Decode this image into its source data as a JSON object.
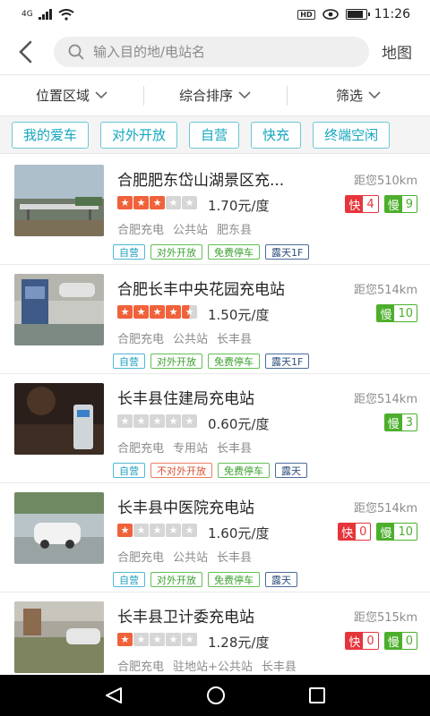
{
  "status_bar": {
    "network": "4G",
    "time": "11:26"
  },
  "header": {
    "back_icon": "back-chevron-icon",
    "search_placeholder": "输入目的地/电站名",
    "map_label": "地图"
  },
  "filters": [
    {
      "label": "位置区域"
    },
    {
      "label": "综合排序"
    },
    {
      "label": "筛选"
    }
  ],
  "quick_tags": [
    "我的爱车",
    "对外开放",
    "自营",
    "快充",
    "终端空闲"
  ],
  "colors": {
    "accent": "#13a7bf",
    "fast": "#e5353b",
    "slow": "#4cae2b",
    "star": "#f0623a",
    "star_empty": "#d6d6d6"
  },
  "stations": [
    {
      "name": "合肥肥东岱山湖景区充...",
      "distance": "距您510km",
      "rating": 3,
      "price": "1.70元/度",
      "operator": "合肥充电",
      "type": "公共站",
      "county": "肥东县",
      "fast": {
        "label": "快",
        "count": "4"
      },
      "slow": {
        "label": "慢",
        "count": "9"
      },
      "tags": [
        {
          "text": "自营",
          "style": "blue"
        },
        {
          "text": "对外开放",
          "style": "green"
        },
        {
          "text": "免费停车",
          "style": "green"
        },
        {
          "text": "露天1F",
          "style": "navy"
        }
      ]
    },
    {
      "name": "合肥长丰中央花园充电站",
      "distance": "距您514km",
      "rating": 4.5,
      "price": "1.50元/度",
      "operator": "合肥充电",
      "type": "公共站",
      "county": "长丰县",
      "fast": null,
      "slow": {
        "label": "慢",
        "count": "10"
      },
      "tags": [
        {
          "text": "自营",
          "style": "blue"
        },
        {
          "text": "对外开放",
          "style": "green"
        },
        {
          "text": "免费停车",
          "style": "green"
        },
        {
          "text": "露天1F",
          "style": "navy"
        }
      ]
    },
    {
      "name": "长丰县住建局充电站",
      "distance": "距您514km",
      "rating": 0,
      "price": "0.60元/度",
      "operator": "合肥充电",
      "type": "专用站",
      "county": "长丰县",
      "fast": null,
      "slow": {
        "label": "慢",
        "count": "3"
      },
      "tags": [
        {
          "text": "自营",
          "style": "blue"
        },
        {
          "text": "不对外开放",
          "style": "red"
        },
        {
          "text": "免费停车",
          "style": "green"
        },
        {
          "text": "露天",
          "style": "navy"
        }
      ]
    },
    {
      "name": "长丰县中医院充电站",
      "distance": "距您514km",
      "rating": 1,
      "price": "1.60元/度",
      "operator": "合肥充电",
      "type": "公共站",
      "county": "长丰县",
      "fast": {
        "label": "快",
        "count": "0"
      },
      "slow": {
        "label": "慢",
        "count": "10"
      },
      "tags": [
        {
          "text": "自营",
          "style": "blue"
        },
        {
          "text": "对外开放",
          "style": "green"
        },
        {
          "text": "免费停车",
          "style": "green"
        },
        {
          "text": "露天",
          "style": "navy"
        }
      ]
    },
    {
      "name": "长丰县卫计委充电站",
      "distance": "距您515km",
      "rating": 1,
      "price": "1.28元/度",
      "operator": "合肥充电",
      "type": "驻地站+公共站",
      "county": "长丰县",
      "fast": {
        "label": "快",
        "count": "0"
      },
      "slow": {
        "label": "慢",
        "count": "0"
      },
      "tags": []
    }
  ]
}
